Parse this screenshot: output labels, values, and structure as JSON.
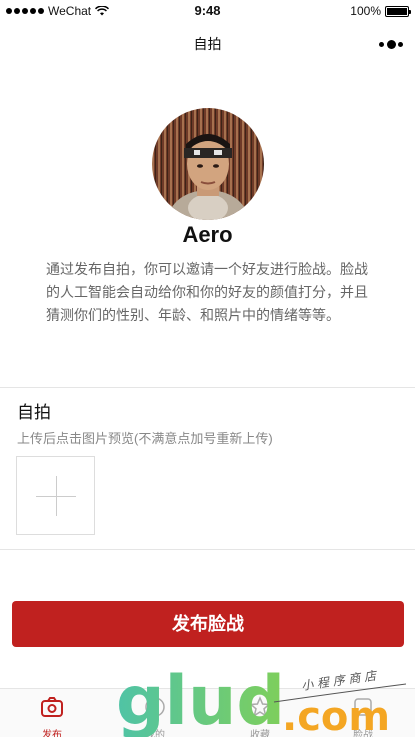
{
  "status_bar": {
    "carrier": "WeChat",
    "time": "9:48",
    "battery": "100%"
  },
  "nav": {
    "title": "自拍"
  },
  "profile": {
    "name": "Aero",
    "description": "通过发布自拍，你可以邀请一个好友进行脸战。脸战的人工智能会自动给你和你的好友的颜值打分，并且猜测你们的性别、年龄、和照片中的情绪等等。"
  },
  "selfie": {
    "title": "自拍",
    "hint": "上传后点击图片预览(不满意点加号重新上传)"
  },
  "publish": {
    "label": "发布脸战"
  },
  "tabs": [
    {
      "label": "发布",
      "icon": "camera-icon",
      "active": true
    },
    {
      "label": "我的",
      "icon": "face-icon",
      "active": false
    },
    {
      "label": "收藏",
      "icon": "star-icon",
      "active": false
    },
    {
      "label": "脸战",
      "icon": "battle-icon",
      "active": false
    }
  ],
  "watermark": {
    "brand": "glud",
    "domain": ".com",
    "tagline": "小 程 序 商 店"
  },
  "colors": {
    "accent": "#c0211f",
    "divider": "#e5e5e5",
    "muted_text": "#888888"
  }
}
